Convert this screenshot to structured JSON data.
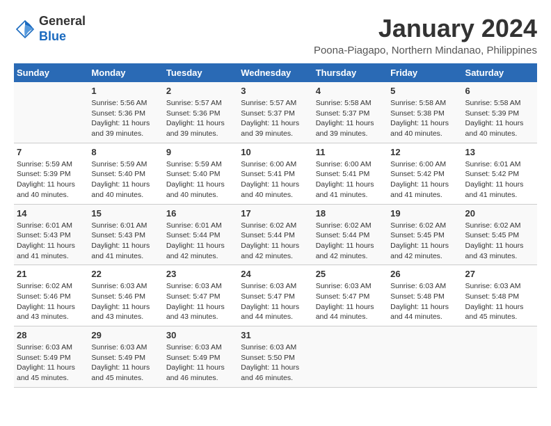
{
  "logo": {
    "general": "General",
    "blue": "Blue"
  },
  "title": "January 2024",
  "subtitle": "Poona-Piagapo, Northern Mindanao, Philippines",
  "days_header": [
    "Sunday",
    "Monday",
    "Tuesday",
    "Wednesday",
    "Thursday",
    "Friday",
    "Saturday"
  ],
  "weeks": [
    [
      {
        "num": "",
        "sunrise": "",
        "sunset": "",
        "daylight": ""
      },
      {
        "num": "1",
        "sunrise": "Sunrise: 5:56 AM",
        "sunset": "Sunset: 5:36 PM",
        "daylight": "Daylight: 11 hours and 39 minutes."
      },
      {
        "num": "2",
        "sunrise": "Sunrise: 5:57 AM",
        "sunset": "Sunset: 5:36 PM",
        "daylight": "Daylight: 11 hours and 39 minutes."
      },
      {
        "num": "3",
        "sunrise": "Sunrise: 5:57 AM",
        "sunset": "Sunset: 5:37 PM",
        "daylight": "Daylight: 11 hours and 39 minutes."
      },
      {
        "num": "4",
        "sunrise": "Sunrise: 5:58 AM",
        "sunset": "Sunset: 5:37 PM",
        "daylight": "Daylight: 11 hours and 39 minutes."
      },
      {
        "num": "5",
        "sunrise": "Sunrise: 5:58 AM",
        "sunset": "Sunset: 5:38 PM",
        "daylight": "Daylight: 11 hours and 40 minutes."
      },
      {
        "num": "6",
        "sunrise": "Sunrise: 5:58 AM",
        "sunset": "Sunset: 5:39 PM",
        "daylight": "Daylight: 11 hours and 40 minutes."
      }
    ],
    [
      {
        "num": "7",
        "sunrise": "Sunrise: 5:59 AM",
        "sunset": "Sunset: 5:39 PM",
        "daylight": "Daylight: 11 hours and 40 minutes."
      },
      {
        "num": "8",
        "sunrise": "Sunrise: 5:59 AM",
        "sunset": "Sunset: 5:40 PM",
        "daylight": "Daylight: 11 hours and 40 minutes."
      },
      {
        "num": "9",
        "sunrise": "Sunrise: 5:59 AM",
        "sunset": "Sunset: 5:40 PM",
        "daylight": "Daylight: 11 hours and 40 minutes."
      },
      {
        "num": "10",
        "sunrise": "Sunrise: 6:00 AM",
        "sunset": "Sunset: 5:41 PM",
        "daylight": "Daylight: 11 hours and 40 minutes."
      },
      {
        "num": "11",
        "sunrise": "Sunrise: 6:00 AM",
        "sunset": "Sunset: 5:41 PM",
        "daylight": "Daylight: 11 hours and 41 minutes."
      },
      {
        "num": "12",
        "sunrise": "Sunrise: 6:00 AM",
        "sunset": "Sunset: 5:42 PM",
        "daylight": "Daylight: 11 hours and 41 minutes."
      },
      {
        "num": "13",
        "sunrise": "Sunrise: 6:01 AM",
        "sunset": "Sunset: 5:42 PM",
        "daylight": "Daylight: 11 hours and 41 minutes."
      }
    ],
    [
      {
        "num": "14",
        "sunrise": "Sunrise: 6:01 AM",
        "sunset": "Sunset: 5:43 PM",
        "daylight": "Daylight: 11 hours and 41 minutes."
      },
      {
        "num": "15",
        "sunrise": "Sunrise: 6:01 AM",
        "sunset": "Sunset: 5:43 PM",
        "daylight": "Daylight: 11 hours and 41 minutes."
      },
      {
        "num": "16",
        "sunrise": "Sunrise: 6:01 AM",
        "sunset": "Sunset: 5:44 PM",
        "daylight": "Daylight: 11 hours and 42 minutes."
      },
      {
        "num": "17",
        "sunrise": "Sunrise: 6:02 AM",
        "sunset": "Sunset: 5:44 PM",
        "daylight": "Daylight: 11 hours and 42 minutes."
      },
      {
        "num": "18",
        "sunrise": "Sunrise: 6:02 AM",
        "sunset": "Sunset: 5:44 PM",
        "daylight": "Daylight: 11 hours and 42 minutes."
      },
      {
        "num": "19",
        "sunrise": "Sunrise: 6:02 AM",
        "sunset": "Sunset: 5:45 PM",
        "daylight": "Daylight: 11 hours and 42 minutes."
      },
      {
        "num": "20",
        "sunrise": "Sunrise: 6:02 AM",
        "sunset": "Sunset: 5:45 PM",
        "daylight": "Daylight: 11 hours and 43 minutes."
      }
    ],
    [
      {
        "num": "21",
        "sunrise": "Sunrise: 6:02 AM",
        "sunset": "Sunset: 5:46 PM",
        "daylight": "Daylight: 11 hours and 43 minutes."
      },
      {
        "num": "22",
        "sunrise": "Sunrise: 6:03 AM",
        "sunset": "Sunset: 5:46 PM",
        "daylight": "Daylight: 11 hours and 43 minutes."
      },
      {
        "num": "23",
        "sunrise": "Sunrise: 6:03 AM",
        "sunset": "Sunset: 5:47 PM",
        "daylight": "Daylight: 11 hours and 43 minutes."
      },
      {
        "num": "24",
        "sunrise": "Sunrise: 6:03 AM",
        "sunset": "Sunset: 5:47 PM",
        "daylight": "Daylight: 11 hours and 44 minutes."
      },
      {
        "num": "25",
        "sunrise": "Sunrise: 6:03 AM",
        "sunset": "Sunset: 5:47 PM",
        "daylight": "Daylight: 11 hours and 44 minutes."
      },
      {
        "num": "26",
        "sunrise": "Sunrise: 6:03 AM",
        "sunset": "Sunset: 5:48 PM",
        "daylight": "Daylight: 11 hours and 44 minutes."
      },
      {
        "num": "27",
        "sunrise": "Sunrise: 6:03 AM",
        "sunset": "Sunset: 5:48 PM",
        "daylight": "Daylight: 11 hours and 45 minutes."
      }
    ],
    [
      {
        "num": "28",
        "sunrise": "Sunrise: 6:03 AM",
        "sunset": "Sunset: 5:49 PM",
        "daylight": "Daylight: 11 hours and 45 minutes."
      },
      {
        "num": "29",
        "sunrise": "Sunrise: 6:03 AM",
        "sunset": "Sunset: 5:49 PM",
        "daylight": "Daylight: 11 hours and 45 minutes."
      },
      {
        "num": "30",
        "sunrise": "Sunrise: 6:03 AM",
        "sunset": "Sunset: 5:49 PM",
        "daylight": "Daylight: 11 hours and 46 minutes."
      },
      {
        "num": "31",
        "sunrise": "Sunrise: 6:03 AM",
        "sunset": "Sunset: 5:50 PM",
        "daylight": "Daylight: 11 hours and 46 minutes."
      },
      {
        "num": "",
        "sunrise": "",
        "sunset": "",
        "daylight": ""
      },
      {
        "num": "",
        "sunrise": "",
        "sunset": "",
        "daylight": ""
      },
      {
        "num": "",
        "sunrise": "",
        "sunset": "",
        "daylight": ""
      }
    ]
  ]
}
